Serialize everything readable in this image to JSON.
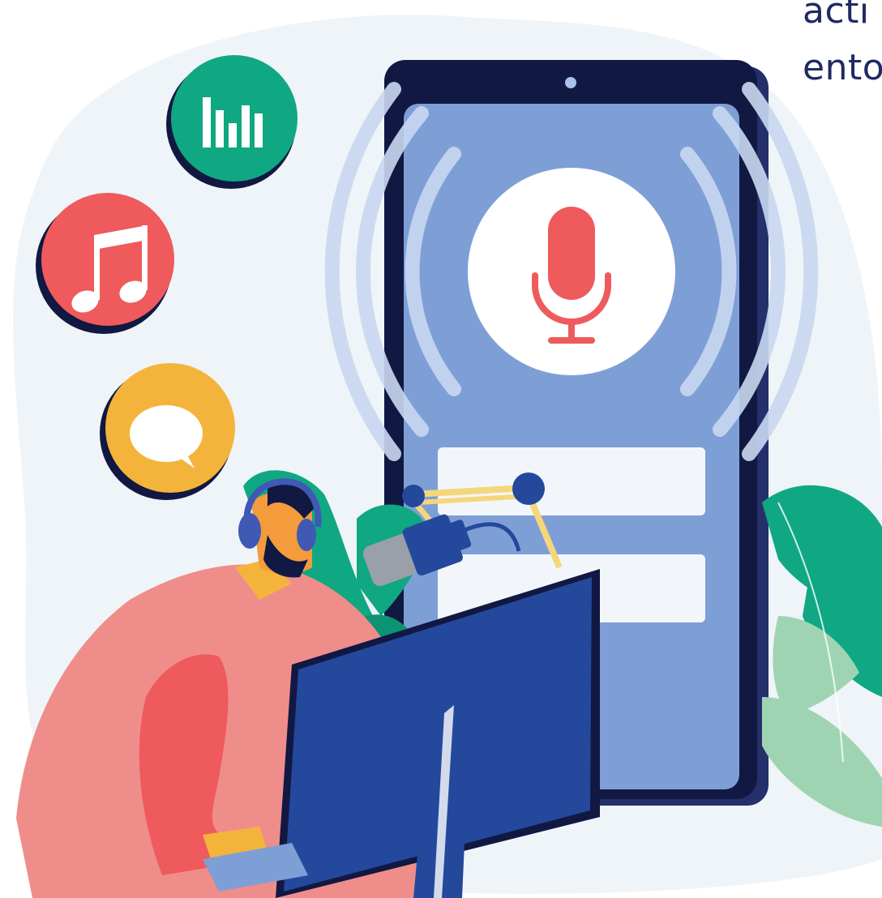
{
  "side_text": {
    "line1": "acti",
    "line2": "ento"
  },
  "icons": [
    "equalizer-icon",
    "music-note-icon",
    "chat-bubble-icon",
    "microphone-icon"
  ],
  "colors": {
    "background_blob": "#eff4f8",
    "phone_body": "#111842",
    "phone_screen": "#7e9fd6",
    "mic_red": "#ef5a5c",
    "green": "#0fa882",
    "yellow": "#f4b43b",
    "monitor_blue": "#24489c",
    "shirt": "#ef8d8b",
    "text": "#1f2a63"
  }
}
